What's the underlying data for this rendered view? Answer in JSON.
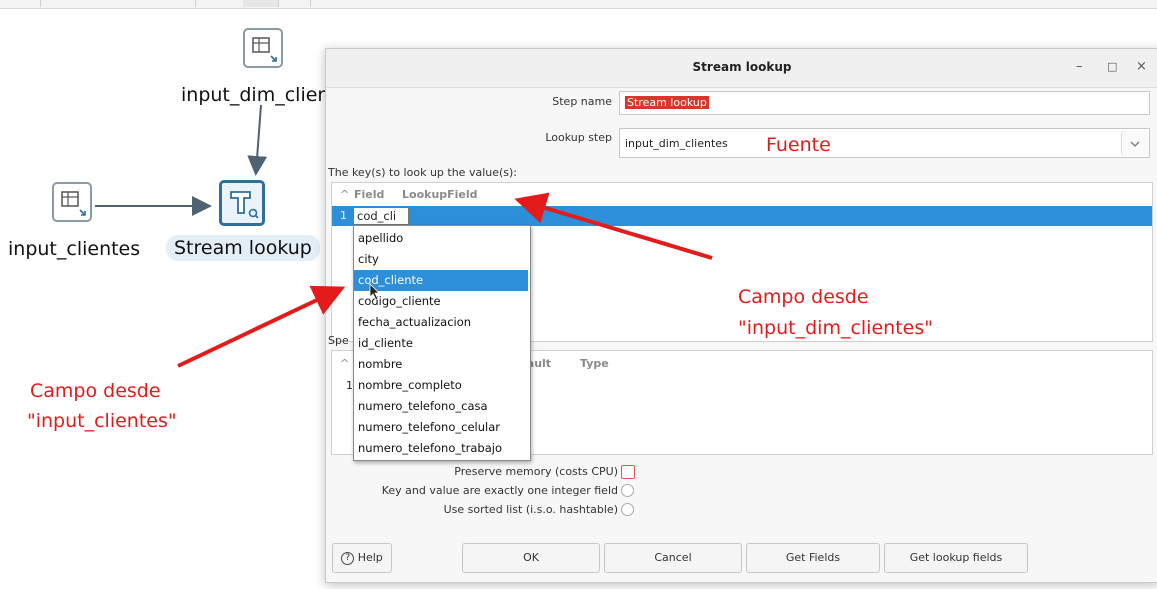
{
  "canvas": {
    "nodes": {
      "input_dim_clientes": "input_dim_clien",
      "input_clientes": "input_clientes",
      "stream_lookup": "Stream lookup"
    }
  },
  "dialog": {
    "title": "Stream lookup",
    "window_controls": {
      "minimize": "–",
      "maximize": "□",
      "close": "×"
    },
    "step_name_label": "Step name",
    "step_name_value": "Stream lookup",
    "lookup_step_label": "Lookup step",
    "lookup_step_value": "input_dim_clientes",
    "keys_label": "The key(s) to look up the value(s):",
    "keys_table": {
      "columns": [
        "Field",
        "LookupField"
      ],
      "rows": [
        {
          "num": "1",
          "field": "cod_cli"
        }
      ]
    },
    "dropdown_options": [
      "apellido",
      "city",
      "cod_cliente",
      "codigo_cliente",
      "fecha_actualizacion",
      "id_cliente",
      "nombre",
      "nombre_completo",
      "numero_telefono_casa",
      "numero_telefono_celular",
      "numero_telefono_trabajo"
    ],
    "highlighted_option": "cod_cliente",
    "specify_label": "Spe",
    "values_table": {
      "columns": [
        "fault",
        "Type"
      ],
      "row_num": "1"
    },
    "options": {
      "preserve_memory": "Preserve memory (costs CPU)",
      "integer_field": "Key and value are exactly one integer field",
      "sorted_list": "Use sorted list (i.s.o. hashtable)"
    },
    "buttons": {
      "help": "Help",
      "ok": "OK",
      "cancel": "Cancel",
      "get_fields": "Get Fields",
      "get_lookup_fields": "Get lookup fields"
    }
  },
  "annotations": {
    "fuente": "Fuente",
    "campo_dim_line1": "Campo desde",
    "campo_dim_line2": "\"input_dim_clientes\"",
    "campo_input_line1": "Campo desde",
    "campo_input_line2": "\"input_clientes\"",
    "color": "#e31b1b"
  },
  "colors": {
    "selection": "#2e8fd9",
    "step_name_highlight": "#d9362b"
  }
}
